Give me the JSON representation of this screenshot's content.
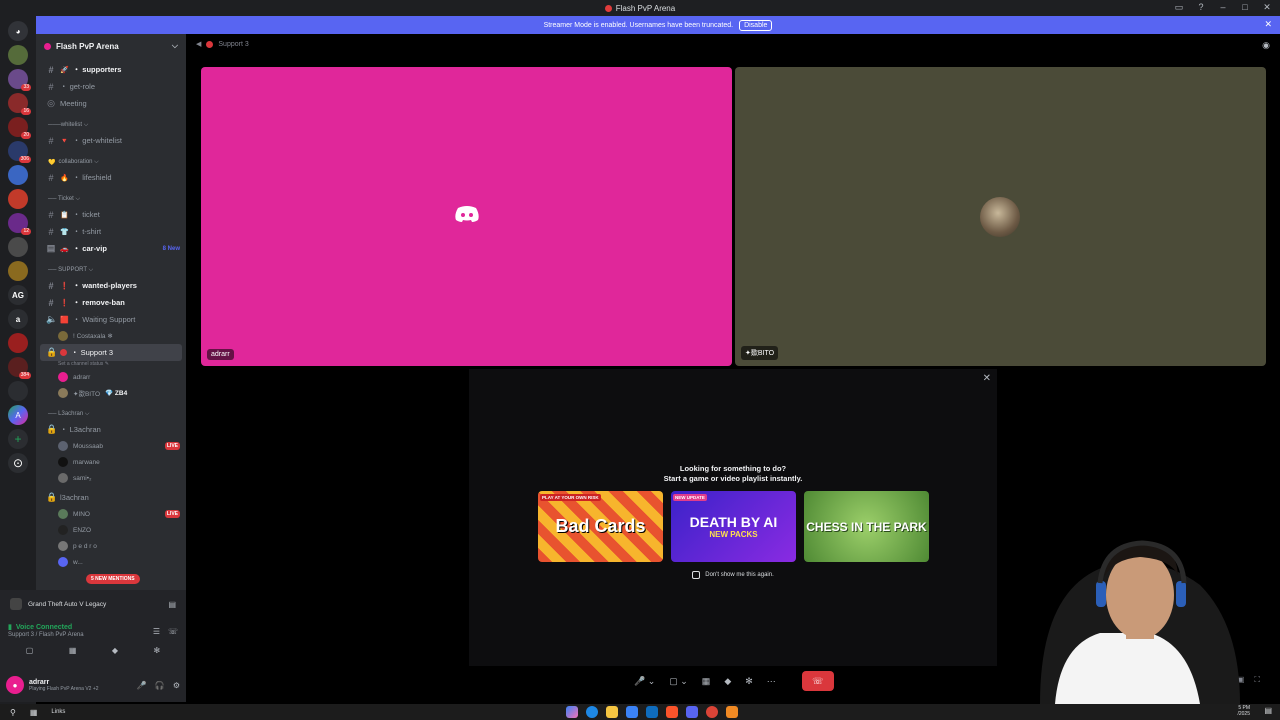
{
  "window": {
    "title": "Flash PvP Arena",
    "controls": [
      "▭",
      "?",
      "–",
      "□",
      "✕"
    ]
  },
  "banner": {
    "message": "Streamer Mode is enabled. Usernames have been truncated.",
    "button": "Disable",
    "close": "✕"
  },
  "rail": {
    "servers": [
      {
        "label": "◕",
        "badge": ""
      },
      {
        "label": "",
        "badge": ""
      },
      {
        "label": "",
        "badge": "33"
      },
      {
        "label": "",
        "badge": "16"
      },
      {
        "label": "",
        "badge": "20"
      },
      {
        "label": "",
        "badge": "306"
      },
      {
        "label": "",
        "badge": ""
      },
      {
        "label": "",
        "badge": ""
      },
      {
        "label": "",
        "badge": "12"
      },
      {
        "label": "",
        "badge": ""
      },
      {
        "label": "",
        "badge": ""
      },
      {
        "label": "AG",
        "badge": ""
      },
      {
        "label": "a",
        "badge": ""
      },
      {
        "label": "",
        "badge": ""
      },
      {
        "label": "",
        "badge": "384"
      },
      {
        "label": "",
        "badge": ""
      },
      {
        "label": "A",
        "badge": ""
      }
    ],
    "add": "+",
    "discover": "⊙"
  },
  "sidebar": {
    "server_name": "Flash PvP Arena",
    "chevron": "⌵",
    "mentions": "5 NEW MENTIONS"
  },
  "channels": {
    "supporters": {
      "emoji": "🚀",
      "name": "・ supporters"
    },
    "get_role": {
      "name": "・ get-role"
    },
    "meeting": {
      "name": "Meeting"
    },
    "cat_whitelist": "───whitelist ⌵",
    "get_whitelist": {
      "emoji": "🔻",
      "name": "・ get-whitelist"
    },
    "cat_collab": "collaboration ⌵",
    "collab_emoji": "💛",
    "lifeshield": {
      "emoji": "🔥",
      "name": "・ lifeshield"
    },
    "cat_ticket": "── Ticket ⌵",
    "ticket": {
      "emoji": "📋",
      "name": "・ ticket"
    },
    "tshirt": {
      "emoji": "👕",
      "name": "・ t-shirt"
    },
    "car_vip": {
      "emoji": "🚗",
      "name": "・ car-vip",
      "tag": "8 New"
    },
    "cat_support": "── SUPPORT ⌵",
    "wanted": {
      "emoji": "❗",
      "name": "・ wanted-players"
    },
    "remove_ban": {
      "emoji": "❗",
      "name": "・ remove-ban"
    },
    "waiting": {
      "emoji": "🟥",
      "name": "・ Waiting Support"
    },
    "costaxala": {
      "name": "! Costaxala ❄"
    },
    "support3": {
      "name": "・ Support 3",
      "status": "Set a channel status ✎"
    },
    "member_adrarr": "adrarr",
    "member_ito": "✦欼BITO",
    "member_ito_tag": "💎 ZB4",
    "cat_l3achran": "── L3achran ⌵",
    "l3achran_ch": {
      "name": "・ L3achran"
    },
    "moussaab": "Moussaab",
    "marwane": "marwane",
    "sami": "sami•₂",
    "l3achran2": {
      "name": "l3achran"
    },
    "mino": "MINO",
    "enzo": "ENZO",
    "pedro": "p e d r o",
    "w": "w...",
    "live": "LIVE"
  },
  "game_activity": {
    "name": "Grand Theft Auto V Legacy"
  },
  "voice": {
    "status": "Voice Connected",
    "location": "Support 3 / Flash PvP Arena"
  },
  "user": {
    "name": "adrarr",
    "status": "Playing Flash PvP Arena V2 +2"
  },
  "stage": {
    "channel": "Support 3",
    "tile_a_name": "adrarr",
    "tile_b_name": "✦欼BITO"
  },
  "popup": {
    "line1": "Looking for something to do?",
    "line2": "Start a game or video playlist instantly.",
    "games": [
      {
        "title": "Bad Cards",
        "tag": "PLAY AT YOUR OWN RISK",
        "sub": ""
      },
      {
        "title": "DEATH BY AI",
        "tag": "NEW UPDATE",
        "sub": "NEW PACKS"
      },
      {
        "title": "CHESS IN THE PARK",
        "tag": "",
        "sub": ""
      }
    ],
    "dont_show": "Don't show me this again."
  },
  "taskbar": {
    "links": "Links",
    "time": "5 PM",
    "date": "/2025"
  },
  "colors": {
    "accent": "#5865f2",
    "danger": "#da373c",
    "online": "#23a55a",
    "tile_a": "#e0279a",
    "tile_b": "#4b4b38"
  }
}
